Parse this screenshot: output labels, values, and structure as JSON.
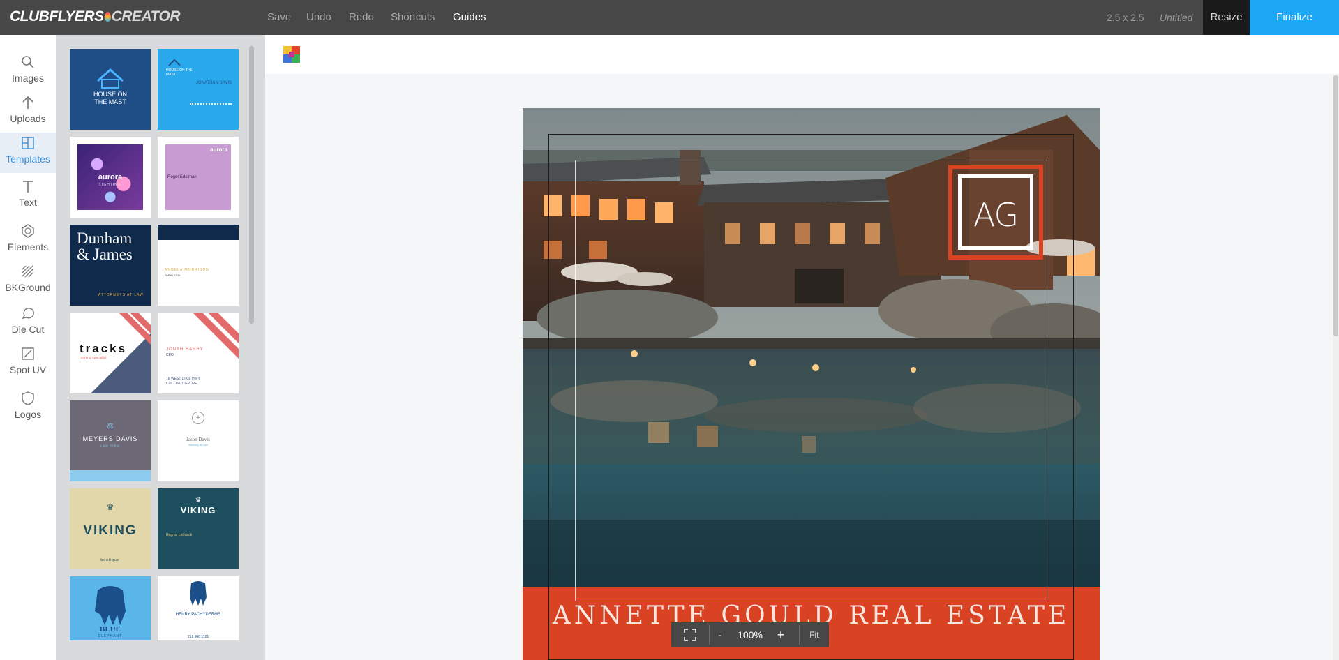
{
  "app": {
    "logo_main": "CLUBFLYERS",
    "logo_sub": "CREATOR"
  },
  "topbar": {
    "nav": [
      "Save",
      "Undo",
      "Redo",
      "Shortcuts",
      "Guides"
    ],
    "active_nav": "Guides",
    "size": "2.5 x 2.5",
    "title": "Untitled",
    "resize_label": "Resize",
    "finalize_label": "Finalize"
  },
  "rail": {
    "items": [
      {
        "label": "Images",
        "icon": "search-icon"
      },
      {
        "label": "Uploads",
        "icon": "upload-arrow-icon"
      },
      {
        "label": "Templates",
        "icon": "templates-icon"
      },
      {
        "label": "Text",
        "icon": "text-icon"
      },
      {
        "label": "Elements",
        "icon": "elements-icon"
      },
      {
        "label": "BKGround",
        "icon": "background-pattern-icon"
      },
      {
        "label": "Die Cut",
        "icon": "die-cut-icon"
      },
      {
        "label": "Spot UV",
        "icon": "spot-uv-icon"
      },
      {
        "label": "Logos",
        "icon": "shield-icon"
      }
    ],
    "active": "Templates"
  },
  "templates": [
    {
      "line1": "HOUSE ON",
      "line2": "THE MAST"
    },
    {
      "line1": "HOUSE ON THE MAST",
      "line2": "JONATHAN DAVIS"
    },
    {
      "line1": "aurora",
      "line2": "LIGHTING"
    },
    {
      "line1": "aurora",
      "line2": "Roger Edelman"
    },
    {
      "line1": "Dunham",
      "line2": "& James",
      "line3": "ATTORNEYS AT LAW"
    },
    {
      "line1": "ANGELA MORRISON",
      "line2": "PARALEGAL"
    },
    {
      "line1": "tracks",
      "line2": "running specialist"
    },
    {
      "line1": "JONAH BARRY",
      "line2": "CEO",
      "line3": "16 WEST DIXIE HWY",
      "line4": "COCONUT GROVE"
    },
    {
      "line1": "MEYERS DAVIS",
      "line2": "LAW FIRM"
    },
    {
      "line1": "Jason Davis",
      "line2": "Attorney at Law"
    },
    {
      "line1": "VIKING",
      "line2": "boutique"
    },
    {
      "line1": "VIKING",
      "line2": "Ragnar Lothbrok"
    },
    {
      "line1": "BLUE",
      "line2": "ELEPHANT"
    },
    {
      "line1": "HENRY PACHYDERMS",
      "line2": "212 968 1121"
    }
  ],
  "design": {
    "monogram": "AG",
    "banner_text": "ANNETTE GOULD REAL ESTATE",
    "accent_color": "#d94222"
  },
  "zoom": {
    "minus": "-",
    "level": "100%",
    "plus": "+",
    "fit": "Fit"
  },
  "colors": {
    "topbar": "#474747",
    "finalize": "#1ea7f5",
    "active_tool": "#3a8fd8"
  }
}
